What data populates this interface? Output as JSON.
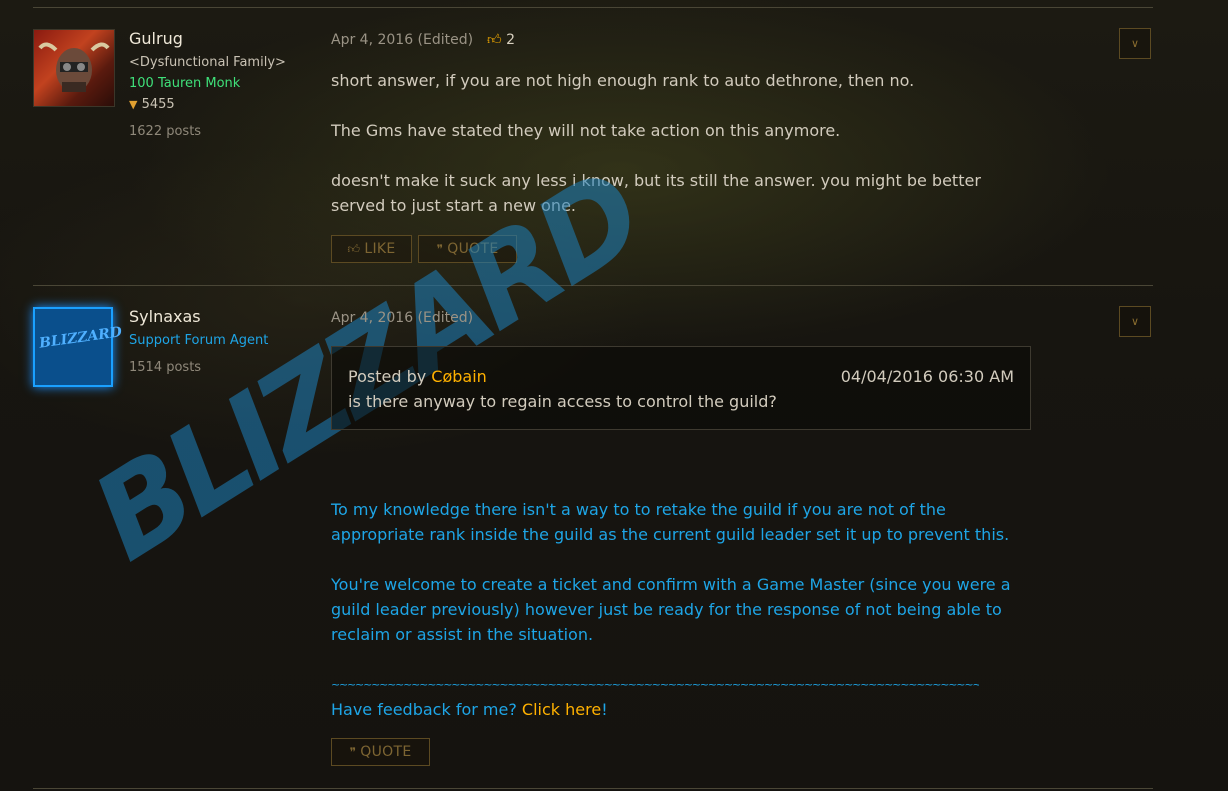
{
  "posts": [
    {
      "author": "Gulrug",
      "guild": "<Dysfunctional Family>",
      "char": "100 Tauren Monk",
      "achievement_points": "5455",
      "post_count": "1622 posts",
      "date": "Apr 4, 2016 (Edited)",
      "likes": "2",
      "body": [
        "short answer, if you are not high enough rank to auto dethrone, then no.",
        "The Gms have stated they will not take action on this anymore.",
        "doesn't make it suck any less i know, but its still the answer. you might be better served to just start a new one."
      ],
      "like_label": "LIKE",
      "quote_label": "QUOTE"
    },
    {
      "author": "Sylnaxas",
      "role": "Support Forum Agent",
      "post_count": "1514 posts",
      "date": "Apr 4, 2016 (Edited)",
      "quote": {
        "prefix": "Posted by",
        "author": "Cøbain",
        "timestamp": "04/04/2016 06:30 AM",
        "text": "is there anyway to regain access to control the guild?"
      },
      "body": [
        "To my knowledge there isn't a way to to retake the guild if you are not of the appropriate rank inside the guild as the current guild leader set it up to prevent this.",
        "You're welcome to create a ticket and confirm with a Game Master (since you were a guild leader previously) however just be ready for the response of not being able to reclaim or assist in the situation."
      ],
      "separator": "~~~~~~~~~~~~~~~~~~~~~~~~~~~~~~~~~~~~~~~~~~~~~~~~~~~~~~~~~~~~~~~~~~~~~~~~~~~~~~~~~~~~~~~~~~~~~",
      "feedback_text": "Have feedback for me?",
      "feedback_link": "Click here",
      "feedback_end": "!",
      "quote_label": "QUOTE"
    }
  ],
  "watermark": "BLIZZARD",
  "avatar_logo": "BLIZZARD",
  "icons": {
    "like": "thumbs-up-icon",
    "quote": "quote-icon",
    "menu": "chevron-down-icon",
    "achievement": "shield-icon"
  }
}
